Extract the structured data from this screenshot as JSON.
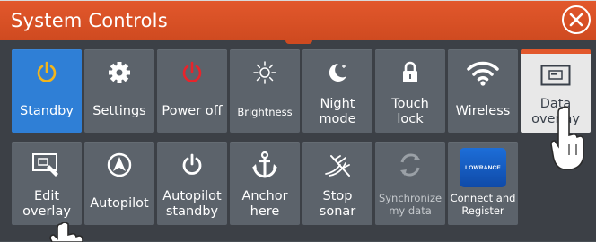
{
  "window": {
    "title": "System Controls"
  },
  "colors": {
    "accent": "#e2582c",
    "active": "#2f7fd6",
    "tile": "#5c636b"
  },
  "tiles": [
    {
      "id": "standby",
      "label": "Standby",
      "icon": "power-icon"
    },
    {
      "id": "settings",
      "label": "Settings",
      "icon": "gear-icon"
    },
    {
      "id": "power-off",
      "label": "Power off",
      "icon": "power-icon"
    },
    {
      "id": "brightness",
      "label": "Brightness",
      "icon": "sun-icon"
    },
    {
      "id": "night-mode",
      "label": "Night\nmode",
      "icon": "moon-icon"
    },
    {
      "id": "touch-lock",
      "label": "Touch\nlock",
      "icon": "lock-icon"
    },
    {
      "id": "wireless",
      "label": "Wireless",
      "icon": "wifi-icon"
    },
    {
      "id": "data-overlay",
      "label": "Data\noverlay",
      "icon": "overlay-icon"
    },
    {
      "id": "edit-overlay",
      "label": "Edit\noverlay",
      "icon": "edit-overlay-icon"
    },
    {
      "id": "autopilot",
      "label": "Autopilot",
      "icon": "autopilot-icon"
    },
    {
      "id": "autopilot-standby",
      "label": "Autopilot\nstandby",
      "icon": "power-icon"
    },
    {
      "id": "anchor-here",
      "label": "Anchor\nhere",
      "icon": "anchor-icon"
    },
    {
      "id": "stop-sonar",
      "label": "Stop\nsonar",
      "icon": "sonar-icon"
    },
    {
      "id": "synchronize",
      "label": "Synchronize\nmy data",
      "icon": "sync-icon"
    },
    {
      "id": "connect-register",
      "label": "Connect and\nRegister",
      "icon": "lowrance-logo",
      "logo_text": "LOWRANCE"
    }
  ]
}
